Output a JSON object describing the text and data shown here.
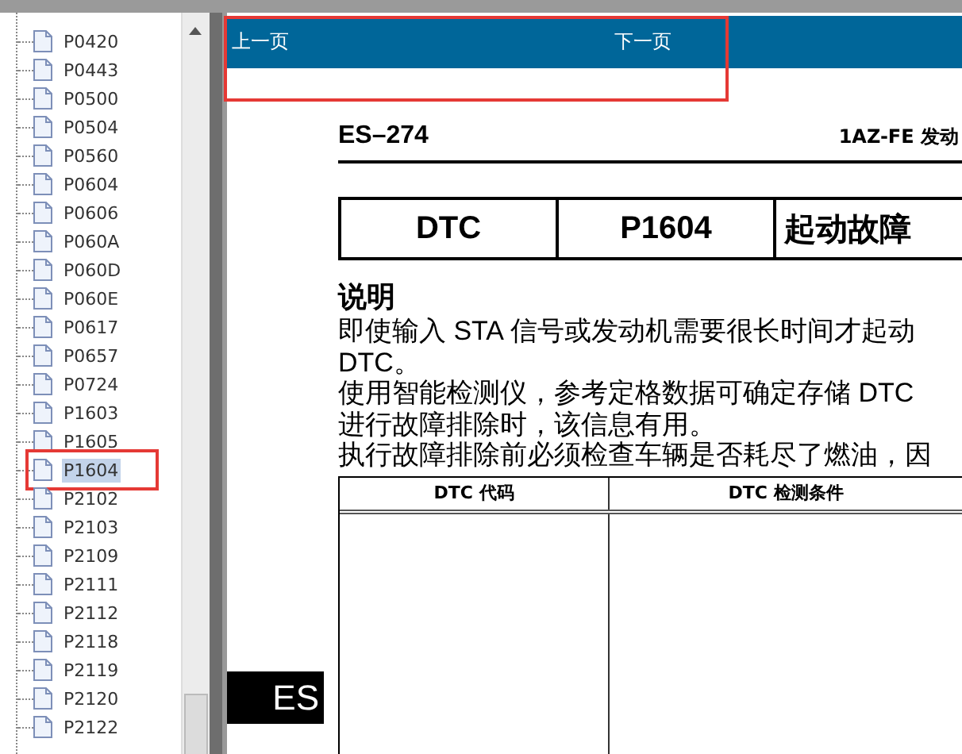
{
  "tree": {
    "items": [
      {
        "label": "P0420",
        "selected": false,
        "annotated": false
      },
      {
        "label": "P0443",
        "selected": false,
        "annotated": false
      },
      {
        "label": "P0500",
        "selected": false,
        "annotated": false
      },
      {
        "label": "P0504",
        "selected": false,
        "annotated": false
      },
      {
        "label": "P0560",
        "selected": false,
        "annotated": false
      },
      {
        "label": "P0604",
        "selected": false,
        "annotated": false
      },
      {
        "label": "P0606",
        "selected": false,
        "annotated": false
      },
      {
        "label": "P060A",
        "selected": false,
        "annotated": false
      },
      {
        "label": "P060D",
        "selected": false,
        "annotated": false
      },
      {
        "label": "P060E",
        "selected": false,
        "annotated": false
      },
      {
        "label": "P0617",
        "selected": false,
        "annotated": false
      },
      {
        "label": "P0657",
        "selected": false,
        "annotated": false
      },
      {
        "label": "P0724",
        "selected": false,
        "annotated": false
      },
      {
        "label": "P1603",
        "selected": false,
        "annotated": false
      },
      {
        "label": "P1605",
        "selected": false,
        "annotated": false
      },
      {
        "label": "P1604",
        "selected": true,
        "annotated": true
      },
      {
        "label": "P2102",
        "selected": false,
        "annotated": false
      },
      {
        "label": "P2103",
        "selected": false,
        "annotated": false
      },
      {
        "label": "P2109",
        "selected": false,
        "annotated": false
      },
      {
        "label": "P2111",
        "selected": false,
        "annotated": false
      },
      {
        "label": "P2112",
        "selected": false,
        "annotated": false
      },
      {
        "label": "P2118",
        "selected": false,
        "annotated": false
      },
      {
        "label": "P2119",
        "selected": false,
        "annotated": false
      },
      {
        "label": "P2120",
        "selected": false,
        "annotated": false
      },
      {
        "label": "P2122",
        "selected": false,
        "annotated": false
      }
    ]
  },
  "nav": {
    "annotated": true,
    "previous": "上一页",
    "next": "下一页"
  },
  "document": {
    "page_number": "ES–274",
    "header_title": "1AZ-FE 发动",
    "dtc_table": [
      "DTC",
      "P1604",
      "起动故障"
    ],
    "section_title": "说明",
    "paragraph_lines": [
      "即使输入 STA 信号或发动机需要很长时间才起动",
      "DTC。",
      "使用智能检测仪，参考定格数据可确定存储 DTC",
      "进行故障排除时，该信息有用。",
      "执行故障排除前必须检查车辆是否耗尽了燃油，因"
    ],
    "table": {
      "columns": [
        "DTC 代码",
        "DTC 检测条件"
      ]
    },
    "side_tab": "ES"
  }
}
